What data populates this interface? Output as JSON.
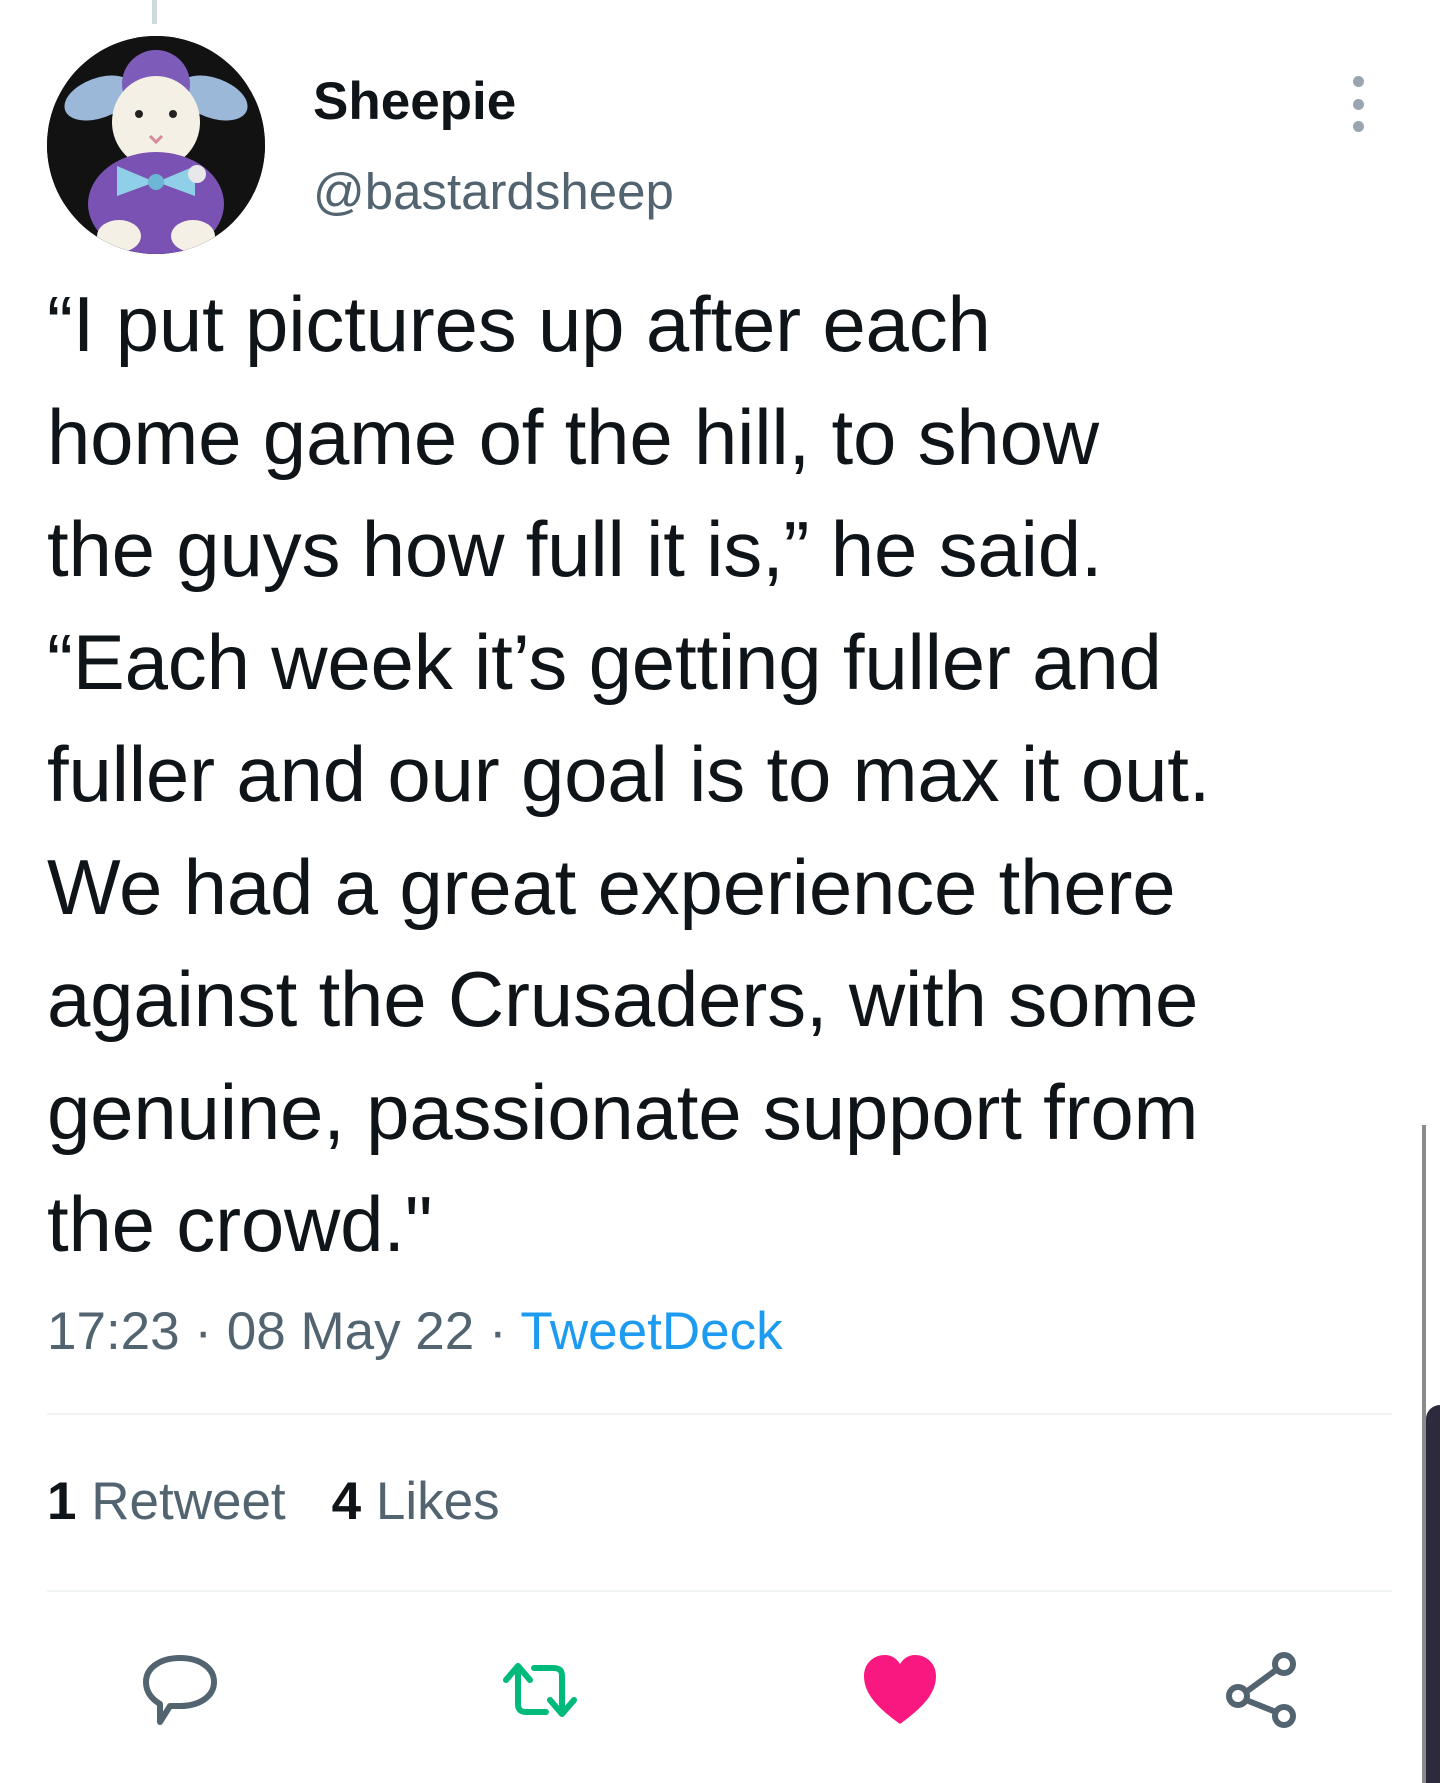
{
  "author": {
    "display_name": "Sheepie",
    "handle": "@bastardsheep",
    "avatar": "plush-sheep-avatar"
  },
  "tweet": {
    "text_lines": [
      "“I put pictures up after each",
      "home game of the hill, to show",
      "the guys how full it is,” he said.",
      "“Each week it’s getting fuller and",
      "fuller and our goal is to max it out.",
      "We had a great experience there",
      "against the Crusaders, with some",
      "genuine, passionate support from",
      "the crowd.\""
    ],
    "time": "17:23",
    "date": "08 May 22",
    "separator": "·",
    "source": "TweetDeck"
  },
  "stats": {
    "retweets_count": "1",
    "retweets_label": "Retweet",
    "likes_count": "4",
    "likes_label": "Likes"
  },
  "actions": {
    "reply_icon": "reply-icon",
    "retweet_icon": "retweet-icon",
    "like_icon": "heart-icon",
    "share_icon": "share-icon"
  },
  "colors": {
    "text": "#0f1419",
    "secondary": "#536471",
    "link": "#1d9bf0",
    "retweet_green": "#00ba7c",
    "like_pink": "#f91880",
    "divider": "#eff3f4"
  }
}
